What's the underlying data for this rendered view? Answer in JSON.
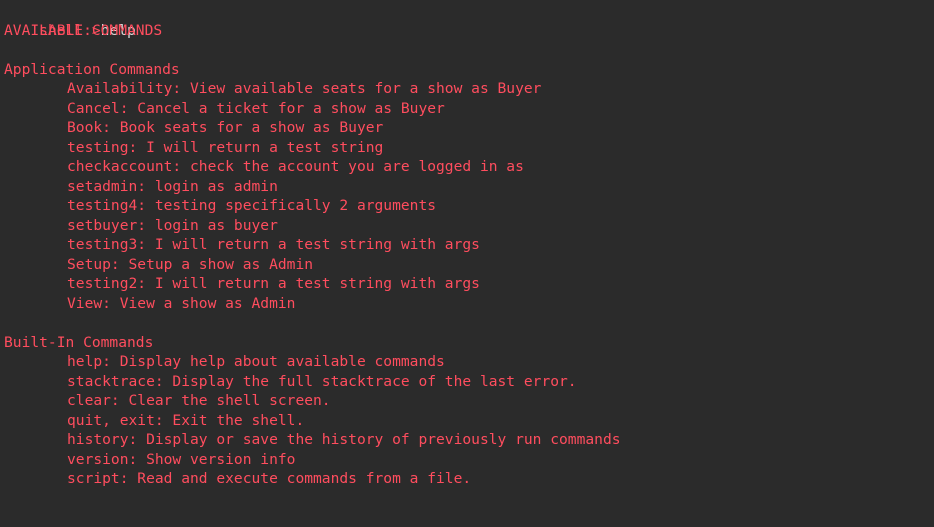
{
  "prompt": {
    "label": "shell:>",
    "typed": "help"
  },
  "header": "AVAILABLE COMMANDS",
  "application": {
    "title": "Application Commands",
    "commands": [
      "Availability: View available seats for a show as Buyer",
      "Cancel: Cancel a ticket for a show as Buyer",
      "Book: Book seats for a show as Buyer",
      "testing: I will return a test string",
      "checkaccount: check the account you are logged in as",
      "setadmin: login as admin",
      "testing4: testing specifically 2 arguments",
      "setbuyer: login as buyer",
      "testing3: I will return a test string with args",
      "Setup: Setup a show as Admin",
      "testing2: I will return a test string with args",
      "View: View a show as Admin"
    ]
  },
  "builtin": {
    "title": "Built-In Commands",
    "commands": [
      "help: Display help about available commands",
      "stacktrace: Display the full stacktrace of the last error.",
      "clear: Clear the shell screen.",
      "quit, exit: Exit the shell.",
      "history: Display or save the history of previously run commands",
      "version: Show version info",
      "script: Read and execute commands from a file."
    ]
  },
  "colors": {
    "background": "#2b2b2b",
    "output": "#ff4d5e",
    "input": "#d7d7d7"
  }
}
